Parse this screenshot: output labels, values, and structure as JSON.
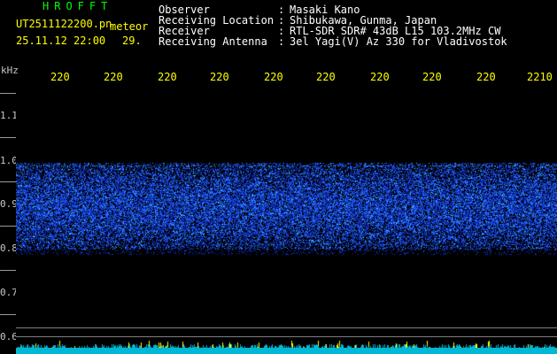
{
  "title_logo": "HROFFT",
  "file": {
    "name": "UT2511122200.pn",
    "type_label": "meteor",
    "datetime": "25.11.12 22:00",
    "count": "29."
  },
  "station": {
    "observer_label": "Observer",
    "observer_value": "Masaki Kano",
    "location_label": "Receiving Location",
    "location_value": "Shibukawa, Gunma, Japan",
    "receiver_label": "Receiver",
    "receiver_value": "RTL-SDR SDR# 43dB L15 103.2MHz CW",
    "antenna_label": "Receiving Antenna",
    "antenna_value": "3el Yagi(V) Az 330 for Vladivostok",
    "sep": ":"
  },
  "axes": {
    "y_unit": "kHz",
    "y_ticks": [
      "1.1",
      "1.0",
      "0.9",
      "0.8",
      "0.7",
      "0.6"
    ],
    "x_ticks": [
      "220",
      "220",
      "220",
      "220",
      "220",
      "220",
      "220",
      "220",
      "220",
      "2210"
    ]
  },
  "colors": {
    "background": "#000000",
    "header_text": "#ffffff",
    "logo": "#00ff00",
    "x_ticks": "#ffff00",
    "noise": "#2050ff",
    "strip": "#00b7d6"
  }
}
